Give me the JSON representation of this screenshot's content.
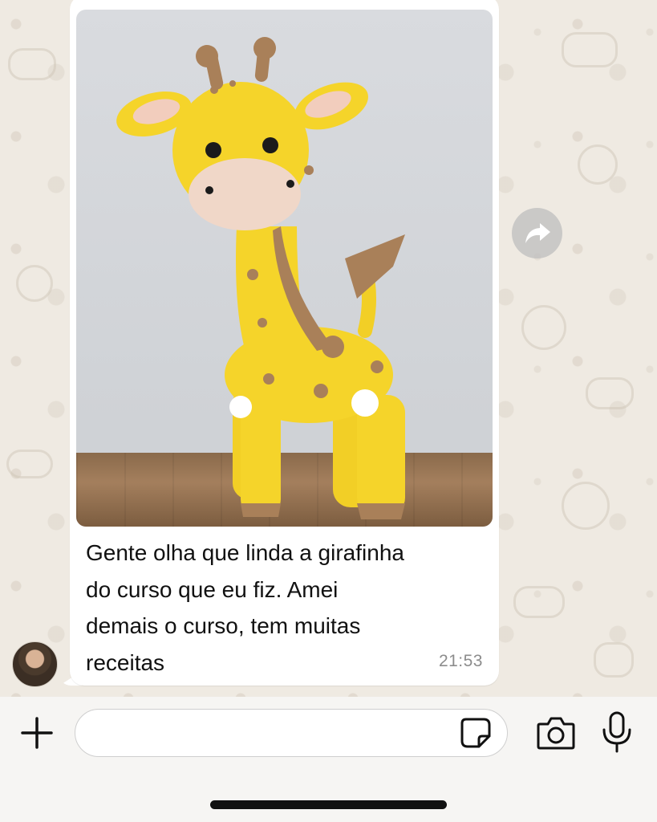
{
  "message": {
    "image_description_icon": "giraffe-plush-photo",
    "text": "Gente olha que linda a girafinha do curso que eu fiz. Amei demais o curso, tem muitas receitas",
    "text_lines": [
      "Gente olha que linda a girafinha",
      "do curso que eu fiz. Amei",
      "demais o curso, tem muitas",
      "receitas"
    ],
    "time": "21:53"
  },
  "actions": {
    "forward_icon": "forward-arrow-icon"
  },
  "composer": {
    "placeholder": "",
    "value": "",
    "attach_icon": "plus-icon",
    "sticker_icon": "sticker-icon",
    "camera_icon": "camera-icon",
    "mic_icon": "microphone-icon"
  },
  "colors": {
    "wallpaper": "#efeae2",
    "bubble": "#ffffff",
    "timestamp": "#8c8c8c"
  }
}
